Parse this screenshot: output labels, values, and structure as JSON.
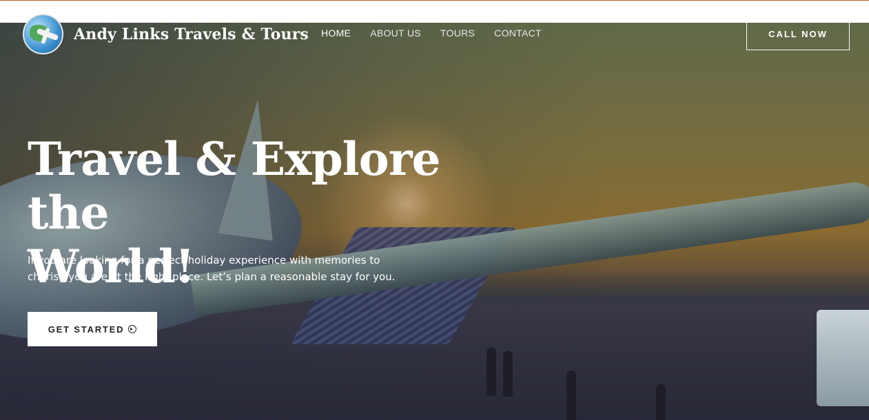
{
  "brand": {
    "name": "Andy Links Travels & Tours",
    "logo_icon": "globe-airplane-logo"
  },
  "nav": {
    "items": [
      {
        "label": "HOME",
        "active": true
      },
      {
        "label": "ABOUT US",
        "active": false
      },
      {
        "label": "TOURS",
        "active": false
      },
      {
        "label": "CONTACT",
        "active": false
      }
    ],
    "call_label": "CALL NOW"
  },
  "hero": {
    "headline_line1": "Travel & Explore the",
    "headline_line2": "World!",
    "subtext": "If you are looking for a perfect holiday experience with memories to cherish you are at the right place. Let’s plan a reasonable stay for you.",
    "cta_label": "GET STARTED",
    "cta_icon": "arrow-circle-right-icon"
  },
  "colors": {
    "accent_line": "#b65e2c",
    "text_primary": "#ffffff",
    "button_bg": "#ffffff",
    "button_text": "#222222"
  }
}
